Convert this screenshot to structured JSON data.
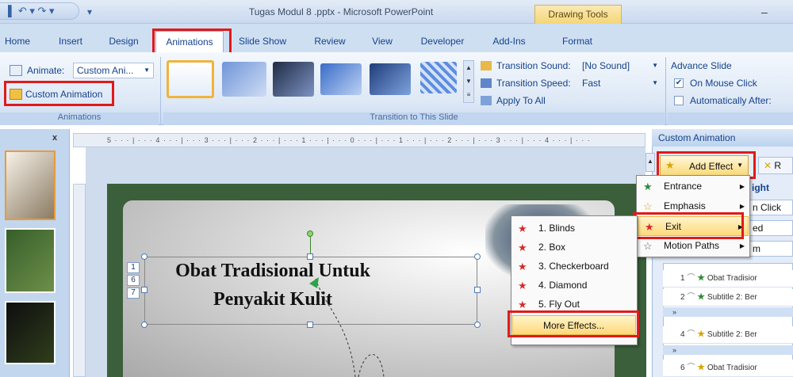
{
  "window": {
    "title": "Tugas Modul 8 .pptx - Microsoft PowerPoint",
    "contextual_tab": "Drawing Tools",
    "minimize_glyph": "–",
    "qat_glyphs": "▌ ↶ ▾ ↷ ▾",
    "qat_end": "▾"
  },
  "tabs": [
    "Home",
    "Insert",
    "Design",
    "Animations",
    "Slide Show",
    "Review",
    "View",
    "Developer",
    "Add-Ins",
    "Format"
  ],
  "ribbon": {
    "animate_label": "Animate:",
    "animate_value": "Custom Ani...",
    "custom_animation_label": "Custom Animation",
    "group_animations": "Animations",
    "group_transition": "Transition to This Slide",
    "transition_sound_label": "Transition Sound:",
    "transition_sound_value": "[No Sound]",
    "transition_speed_label": "Transition Speed:",
    "transition_speed_value": "Fast",
    "apply_to_all": "Apply To All",
    "advance_slide": "Advance Slide",
    "on_mouse_click": "On Mouse Click",
    "on_mouse_click_checked": true,
    "automatically_after": "Automatically After:",
    "automatically_after_checked": false
  },
  "ruler_text": "5 · · · | · · · 4 · · · | · · · 3 · · · | · · · 2 · · · | · · · 1 · · · | · · · 0 · · · | · · · 1 · · · | · · · 2 · · · | · · · 3 · · · | · · · 4 · · · | · · ·",
  "left_pane": {
    "close": "x"
  },
  "slide": {
    "title_line1": "Obat Tradisional Untuk",
    "title_line2": "Penyakit Kulit",
    "tags": [
      "1",
      "6",
      "7"
    ]
  },
  "custom_animation_pane": {
    "title": "Custom Animation",
    "add_effect": "Add Effect",
    "remove_partial": "R",
    "partial_right": "ight",
    "partial_click": "n Click",
    "partial_ed": "ed",
    "partial_m": "m",
    "list": [
      {
        "num": "1",
        "label": "Obat Tradisior"
      },
      {
        "num": "2",
        "label": "Subtitle 2: Ber"
      },
      {
        "num": "4",
        "label": "Subtitle 2: Ber"
      },
      {
        "num": "6",
        "label": "Obat Tradisior"
      }
    ]
  },
  "add_effect_menu": [
    {
      "label": "Entrance",
      "color": "#2e8b3d"
    },
    {
      "label": "Emphasis",
      "color": "#d9a400"
    },
    {
      "label": "Exit",
      "color": "#d42a2a"
    },
    {
      "label": "Motion Paths",
      "color": "#555555"
    }
  ],
  "exit_submenu": [
    "1. Blinds",
    "2. Box",
    "3. Checkerboard",
    "4. Diamond",
    "5. Fly Out"
  ],
  "more_effects": "More Effects..."
}
